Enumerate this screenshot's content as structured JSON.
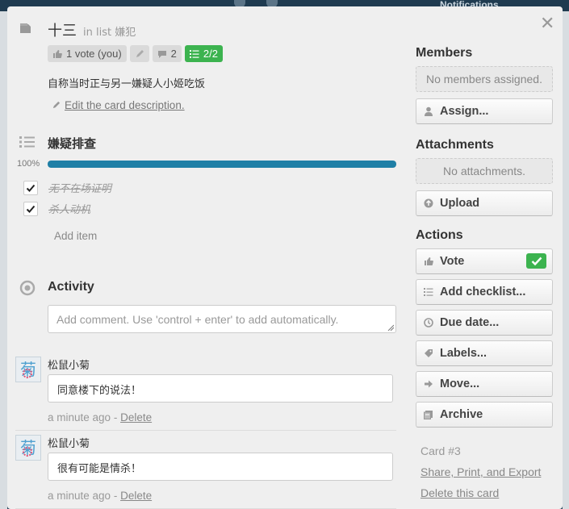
{
  "background": {
    "notifications_label": "Notifications"
  },
  "card": {
    "title": "十三",
    "in_list": "in list 嫌犯",
    "badges": {
      "votes": "1 vote (you)",
      "comments": "2",
      "checklist": "2/2"
    },
    "description": "自称当时正与另一嫌疑人小姬吃饭",
    "edit_description_label": "Edit the card description."
  },
  "checklist": {
    "title": "嫌疑排查",
    "percent_label": "100%",
    "progress": 1.0,
    "items": [
      {
        "text": "无不在场证明",
        "checked": true
      },
      {
        "text": "杀人动机",
        "checked": true
      }
    ],
    "add_item_label": "Add item"
  },
  "activity": {
    "title": "Activity",
    "comment_placeholder": "Add comment. Use 'control + enter' to add automatically.",
    "comments": [
      {
        "author": "松鼠小菊",
        "text": "同意楼下的说法！",
        "time": "a minute ago",
        "delete_label": "Delete"
      },
      {
        "author": "松鼠小菊",
        "text": "很有可能是情杀！",
        "time": "a minute ago",
        "delete_label": "Delete"
      }
    ]
  },
  "sidebar": {
    "members_title": "Members",
    "members_empty": "No members assigned.",
    "assign_label": "Assign...",
    "attachments_title": "Attachments",
    "attachments_empty": "No attachments.",
    "upload_label": "Upload",
    "actions_title": "Actions",
    "actions": {
      "vote": "Vote",
      "add_checklist": "Add checklist...",
      "due_date": "Due date...",
      "labels": "Labels...",
      "move": "Move...",
      "archive": "Archive"
    },
    "card_number": "Card #3",
    "share_label": "Share, Print, and Export",
    "delete_label": "Delete this card"
  },
  "colors": {
    "progress": "#1f7fa6",
    "badge_green": "#3cb34f",
    "dialog_bg": "#efefef",
    "board_bg": "#23425a"
  }
}
